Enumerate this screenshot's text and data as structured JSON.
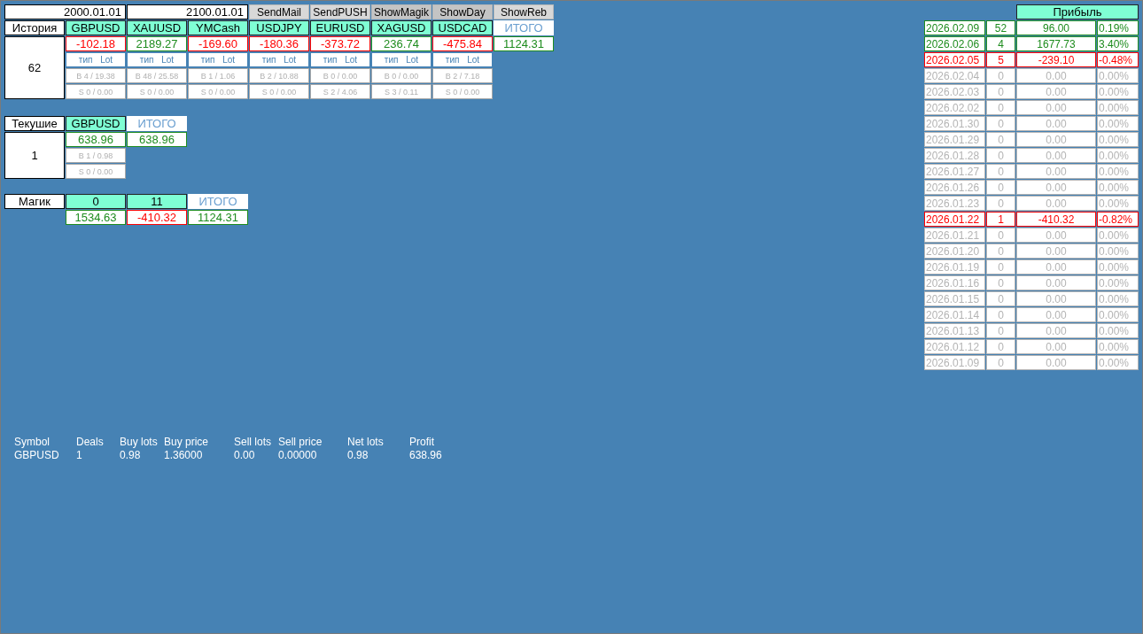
{
  "history": {
    "date_from": "2000.01.01",
    "date_to": "2100.01.01",
    "buttons": [
      {
        "label": "SendMail",
        "pressed": false
      },
      {
        "label": "SendPUSH",
        "pressed": false
      },
      {
        "label": "ShowMagik",
        "pressed": true
      },
      {
        "label": "ShowDay",
        "pressed": true
      },
      {
        "label": "ShowReb",
        "pressed": false
      }
    ],
    "label": "История",
    "count": "62",
    "columns": [
      {
        "symbol": "GBPUSD",
        "value": "-102.18",
        "color": "#ff0000",
        "type_lot": "тип Lot",
        "buy": "B 4 / 19.38",
        "sell": "S 0 / 0.00"
      },
      {
        "symbol": "XAUUSD",
        "value": "2189.27",
        "color": "#1e8c1e",
        "type_lot": "тип Lot",
        "buy": "B 48 / 25.58",
        "sell": "S 0 / 0.00"
      },
      {
        "symbol": "YMCash",
        "value": "-169.60",
        "color": "#ff0000",
        "type_lot": "тип Lot",
        "buy": "B 1 / 1.06",
        "sell": "S 0 / 0.00"
      },
      {
        "symbol": "USDJPY",
        "value": "-180.36",
        "color": "#ff0000",
        "type_lot": "тип Lot",
        "buy": "B 2 / 10.88",
        "sell": "S 0 / 0.00"
      },
      {
        "symbol": "EURUSD",
        "value": "-373.72",
        "color": "#ff0000",
        "type_lot": "тип Lot",
        "buy": "B 0 / 0.00",
        "sell": "S 2 / 4.06"
      },
      {
        "symbol": "XAGUSD",
        "value": "236.74",
        "color": "#1e8c1e",
        "type_lot": "тип Lot",
        "buy": "B 0 / 0.00",
        "sell": "S 3 / 0.11"
      },
      {
        "symbol": "USDCAD",
        "value": "-475.84",
        "color": "#ff0000",
        "type_lot": "тип Lot",
        "buy": "B 2 / 7.18",
        "sell": "S 0 / 0.00"
      }
    ],
    "total": {
      "label": "ИТОГО",
      "value": "1124.31",
      "color": "#1e8c1e"
    }
  },
  "current": {
    "label": "Текушие",
    "count": "1",
    "columns": [
      {
        "symbol": "GBPUSD",
        "value": "638.96",
        "color": "#1e8c1e",
        "buy": "B 1 / 0.98",
        "sell": "S 0 / 0.00"
      }
    ],
    "total": {
      "label": "ИТОГО",
      "value": "638.96",
      "color": "#1e8c1e"
    }
  },
  "magic": {
    "label": "Магик",
    "columns": [
      {
        "magic": "0",
        "value": "1534.63",
        "color": "#1e8c1e"
      },
      {
        "magic": "11",
        "value": "-410.32",
        "color": "#ff0000"
      }
    ],
    "total": {
      "label": "ИТОГО",
      "value": "1124.31",
      "color": "#1e8c1e"
    }
  },
  "daily": {
    "header": "Прибыль",
    "rows": [
      {
        "date": "2026.02.09",
        "deals": "52",
        "profit": "96.00",
        "percent": "0.19%",
        "color": "#1e8c1e"
      },
      {
        "date": "2026.02.06",
        "deals": "4",
        "profit": "1677.73",
        "percent": "3.40%",
        "color": "#1e8c1e"
      },
      {
        "date": "2026.02.05",
        "deals": "5",
        "profit": "-239.10",
        "percent": "-0.48%",
        "color": "#ff0000"
      },
      {
        "date": "2026.02.04",
        "deals": "0",
        "profit": "0.00",
        "percent": "0.00%",
        "color": "#b4b4b4"
      },
      {
        "date": "2026.02.03",
        "deals": "0",
        "profit": "0.00",
        "percent": "0.00%",
        "color": "#b4b4b4"
      },
      {
        "date": "2026.02.02",
        "deals": "0",
        "profit": "0.00",
        "percent": "0.00%",
        "color": "#b4b4b4"
      },
      {
        "date": "2026.01.30",
        "deals": "0",
        "profit": "0.00",
        "percent": "0.00%",
        "color": "#b4b4b4"
      },
      {
        "date": "2026.01.29",
        "deals": "0",
        "profit": "0.00",
        "percent": "0.00%",
        "color": "#b4b4b4"
      },
      {
        "date": "2026.01.28",
        "deals": "0",
        "profit": "0.00",
        "percent": "0.00%",
        "color": "#b4b4b4"
      },
      {
        "date": "2026.01.27",
        "deals": "0",
        "profit": "0.00",
        "percent": "0.00%",
        "color": "#b4b4b4"
      },
      {
        "date": "2026.01.26",
        "deals": "0",
        "profit": "0.00",
        "percent": "0.00%",
        "color": "#b4b4b4"
      },
      {
        "date": "2026.01.23",
        "deals": "0",
        "profit": "0.00",
        "percent": "0.00%",
        "color": "#b4b4b4"
      },
      {
        "date": "2026.01.22",
        "deals": "1",
        "profit": "-410.32",
        "percent": "-0.82%",
        "color": "#ff0000"
      },
      {
        "date": "2026.01.21",
        "deals": "0",
        "profit": "0.00",
        "percent": "0.00%",
        "color": "#b4b4b4"
      },
      {
        "date": "2026.01.20",
        "deals": "0",
        "profit": "0.00",
        "percent": "0.00%",
        "color": "#b4b4b4"
      },
      {
        "date": "2026.01.19",
        "deals": "0",
        "profit": "0.00",
        "percent": "0.00%",
        "color": "#b4b4b4"
      },
      {
        "date": "2026.01.16",
        "deals": "0",
        "profit": "0.00",
        "percent": "0.00%",
        "color": "#b4b4b4"
      },
      {
        "date": "2026.01.15",
        "deals": "0",
        "profit": "0.00",
        "percent": "0.00%",
        "color": "#b4b4b4"
      },
      {
        "date": "2026.01.14",
        "deals": "0",
        "profit": "0.00",
        "percent": "0.00%",
        "color": "#b4b4b4"
      },
      {
        "date": "2026.01.13",
        "deals": "0",
        "profit": "0.00",
        "percent": "0.00%",
        "color": "#b4b4b4"
      },
      {
        "date": "2026.01.12",
        "deals": "0",
        "profit": "0.00",
        "percent": "0.00%",
        "color": "#b4b4b4"
      },
      {
        "date": "2026.01.09",
        "deals": "0",
        "profit": "0.00",
        "percent": "0.00%",
        "color": "#b4b4b4"
      }
    ]
  },
  "positions": {
    "columns": [
      "Symbol",
      "Deals",
      "Buy lots",
      "Buy price",
      "Sell lots",
      "Sell price",
      "Net lots",
      "Profit"
    ],
    "rows": [
      [
        "GBPUSD",
        "1",
        "0.98",
        "1.36000",
        "0.00",
        "0.00000",
        "0.98",
        "638.96"
      ]
    ]
  }
}
